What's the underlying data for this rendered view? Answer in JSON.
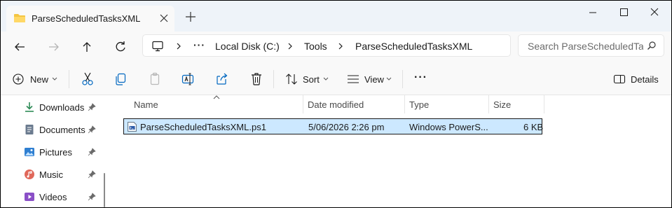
{
  "tab": {
    "title": "ParseScheduledTasksXML"
  },
  "address": {
    "breadcrumb": [
      "Local Disk (C:)",
      "Tools",
      "ParseScheduledTasksXML"
    ],
    "more": "···"
  },
  "search": {
    "placeholder": "Search ParseScheduledTasksXML"
  },
  "toolbar": {
    "new_label": "New",
    "sort_label": "Sort",
    "view_label": "View",
    "more_label": "···",
    "details_label": "Details"
  },
  "sidebar": {
    "items": [
      {
        "label": "Downloads",
        "icon": "download-icon"
      },
      {
        "label": "Documents",
        "icon": "documents-icon"
      },
      {
        "label": "Pictures",
        "icon": "pictures-icon"
      },
      {
        "label": "Music",
        "icon": "music-icon"
      },
      {
        "label": "Videos",
        "icon": "videos-icon"
      }
    ]
  },
  "columns": {
    "name": "Name",
    "date": "Date modified",
    "type": "Type",
    "size": "Size"
  },
  "files": [
    {
      "name": "ParseScheduledTasksXML.ps1",
      "date": "5/06/2026 2:26 pm",
      "type": "Windows PowerS...",
      "size": "6 KB"
    }
  ],
  "colors": {
    "accent": "#0067c0",
    "selection": "#cce8ff",
    "folder": "#f4c542"
  }
}
